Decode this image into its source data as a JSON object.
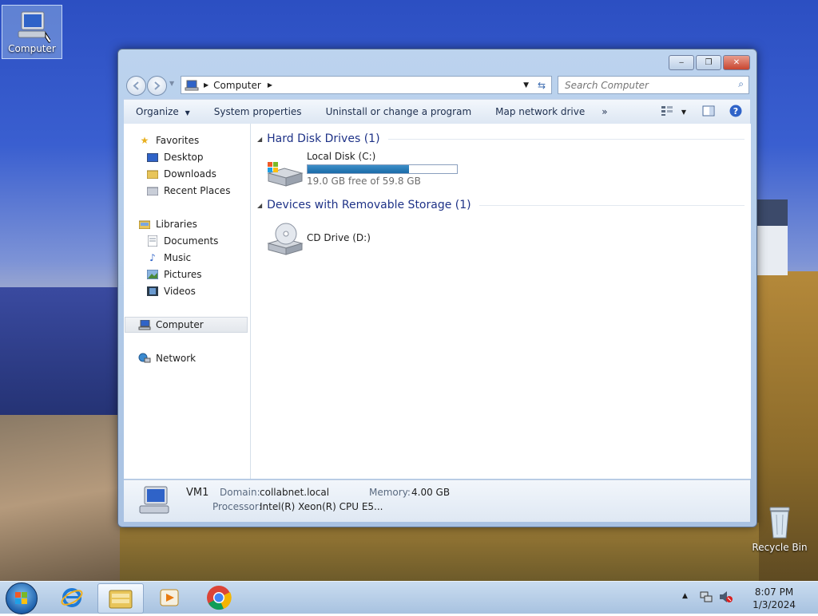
{
  "desktop": {
    "icons": [
      {
        "label": "Computer"
      },
      {
        "label": "Recycle Bin"
      }
    ]
  },
  "address_bar": {
    "path": "Computer"
  },
  "search": {
    "placeholder": "Search Computer"
  },
  "toolbar": {
    "organize": "Organize",
    "system_properties": "System properties",
    "uninstall": "Uninstall or change a program",
    "map_network": "Map network drive",
    "more": "»"
  },
  "nav_pane": {
    "favorites": "Favorites",
    "desktop": "Desktop",
    "downloads": "Downloads",
    "recent_places": "Recent Places",
    "libraries": "Libraries",
    "documents": "Documents",
    "music": "Music",
    "pictures": "Pictures",
    "videos": "Videos",
    "computer": "Computer",
    "network": "Network"
  },
  "content": {
    "hard_disk_group": "Hard Disk Drives (1)",
    "removable_group": "Devices with Removable Storage (1)",
    "local_disk": {
      "name": "Local Disk (C:)",
      "free_text": "19.0 GB free of 59.8 GB",
      "used_fraction": 0.68
    },
    "cd_drive": {
      "name": "CD Drive (D:)"
    }
  },
  "details": {
    "computer_name": "VM1",
    "domain_label": "Domain:",
    "domain_value": "collabnet.local",
    "memory_label": "Memory:",
    "memory_value": "4.00 GB",
    "processor_label": "Processor:",
    "processor_value": "Intel(R) Xeon(R) CPU E5..."
  },
  "taskbar": {
    "time": "8:07 PM",
    "date": "1/3/2024"
  }
}
